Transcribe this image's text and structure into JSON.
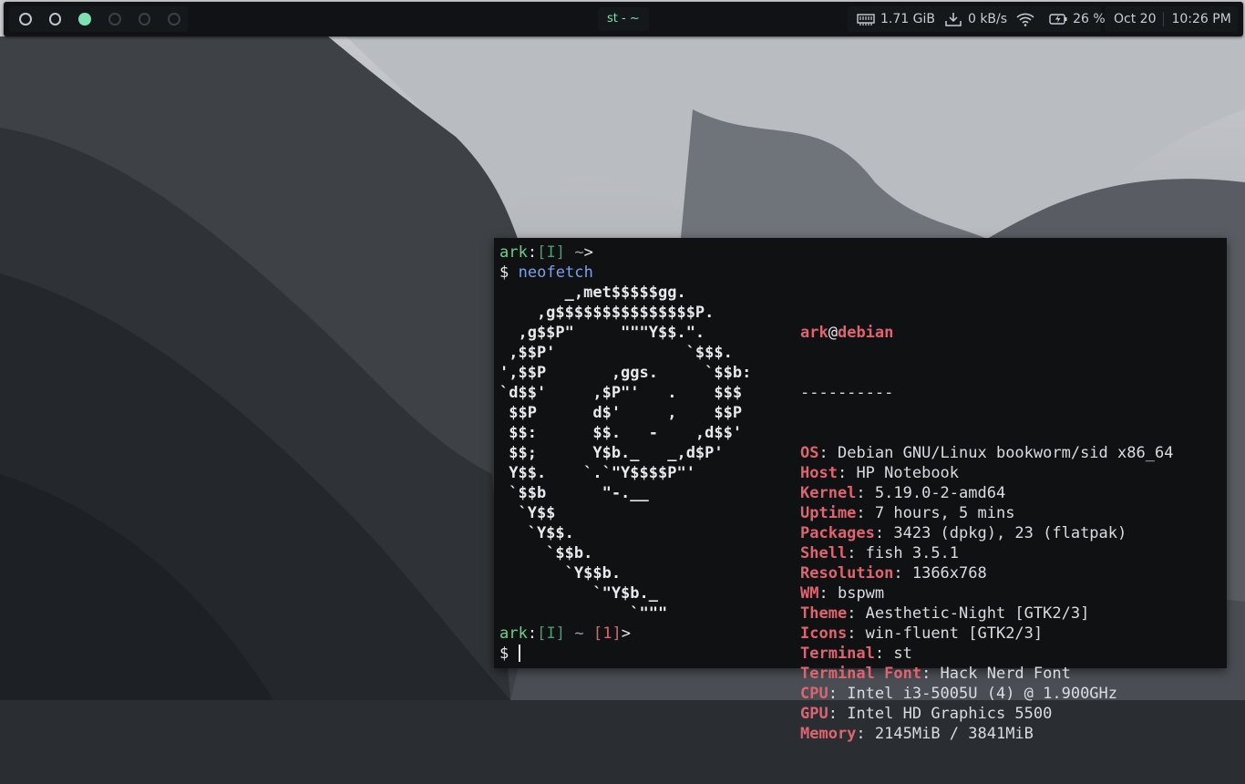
{
  "bar": {
    "workspaces": [
      {
        "state": "occupied"
      },
      {
        "state": "occupied"
      },
      {
        "state": "focused"
      },
      {
        "state": "empty"
      },
      {
        "state": "empty"
      },
      {
        "state": "empty"
      }
    ],
    "window_title": "st - ~",
    "memory": "1.71 GiB",
    "net_speed": "0 kB/s",
    "battery": "26 %",
    "date": "Oct 20",
    "time": "10:26 PM",
    "icons": {
      "memory": "ram-icon",
      "download": "download-icon",
      "wifi": "wifi-icon",
      "battery": "battery-charging-icon"
    },
    "accent": "#7fe0b4"
  },
  "terminal": {
    "prompt1": {
      "user": "ark",
      "mode": "[I]",
      "dir": "~",
      "end": ">"
    },
    "cmd_symbol": "$",
    "command": "neofetch",
    "ascii_art": [
      "       _,met$$$$$gg.",
      "    ,g$$$$$$$$$$$$$$$P.",
      "  ,g$$P\"     \"\"\"Y$$.\".",
      " ,$$P'              `$$$.",
      "',$$P       ,ggs.     `$$b:",
      "`d$$'     ,$P\"'   .    $$$",
      " $$P      d$'     ,    $$P",
      " $$:      $$.   -    ,d$$'",
      " $$;      Y$b._   _,d$P'",
      " Y$$.    `.`\"Y$$$$P\"'",
      " `$$b      \"-.__",
      "  `Y$$",
      "   `Y$$.",
      "     `$$b.",
      "       `Y$$b.",
      "          `\"Y$b._",
      "              `\"\"\""
    ],
    "info_header_user": "ark",
    "info_header_at": "@",
    "info_header_host": "debian",
    "separator": "----------",
    "info": [
      {
        "key": "OS",
        "value": "Debian GNU/Linux bookworm/sid x86_64"
      },
      {
        "key": "Host",
        "value": "HP Notebook"
      },
      {
        "key": "Kernel",
        "value": "5.19.0-2-amd64"
      },
      {
        "key": "Uptime",
        "value": "7 hours, 5 mins"
      },
      {
        "key": "Packages",
        "value": "3423 (dpkg), 23 (flatpak)"
      },
      {
        "key": "Shell",
        "value": "fish 3.5.1"
      },
      {
        "key": "Resolution",
        "value": "1366x768"
      },
      {
        "key": "WM",
        "value": "bspwm"
      },
      {
        "key": "Theme",
        "value": "Aesthetic-Night [GTK2/3]"
      },
      {
        "key": "Icons",
        "value": "win-fluent [GTK2/3]"
      },
      {
        "key": "Terminal",
        "value": "st"
      },
      {
        "key": "Terminal Font",
        "value": "Hack Nerd Font"
      },
      {
        "key": "CPU",
        "value": "Intel i3-5005U (4) @ 1.900GHz"
      },
      {
        "key": "GPU",
        "value": "Intel HD Graphics 5500"
      },
      {
        "key": "Memory",
        "value": "2145MiB / 3841MiB"
      }
    ],
    "prompt2": {
      "user": "ark",
      "mode": "[I]",
      "dir": "~",
      "status": "[1]",
      "end": ">"
    }
  }
}
